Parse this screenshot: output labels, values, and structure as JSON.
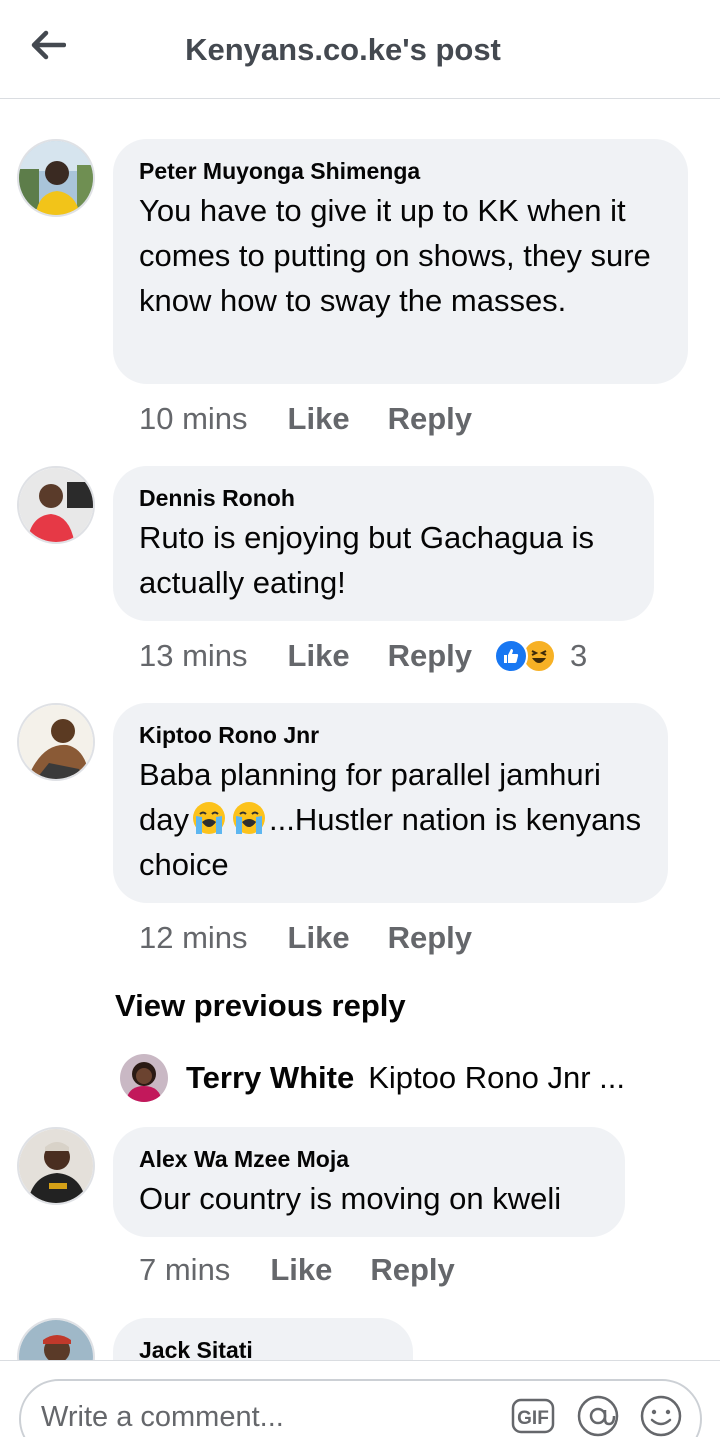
{
  "header": {
    "title": "Kenyans.co.ke's post",
    "back_icon": "arrow-left-icon"
  },
  "comments": [
    {
      "author": "Peter Muyonga Shimenga",
      "text": "You have to give it up to KK when it comes to putting on shows, they sure know how to sway the masses.",
      "time": "10 mins",
      "like": "Like",
      "reply": "Reply"
    },
    {
      "author": "Dennis Ronoh",
      "text": "Ruto is enjoying but Gachagua is actually eating!",
      "time": "13 mins",
      "like": "Like",
      "reply": "Reply",
      "reactions": {
        "icons": [
          "like-reaction-icon",
          "haha-reaction-icon"
        ],
        "count": "3"
      }
    },
    {
      "author": "Kiptoo Rono Jnr",
      "text_before": "Baba planning for parallel jamhuri day",
      "text_after": "...Hustler nation  is kenyans choice",
      "emojis": [
        "loudly-crying-face-icon",
        "loudly-crying-face-icon"
      ],
      "time": "12 mins",
      "like": "Like",
      "reply": "Reply"
    },
    {
      "author": "Alex Wa Mzee Moja",
      "text": "Our country is moving on kweli",
      "time": "7 mins",
      "like": "Like",
      "reply": "Reply"
    },
    {
      "author": "Jack Sitati"
    }
  ],
  "replies": {
    "view_previous": "View previous reply",
    "preview_name": "Terry White",
    "preview_text": "Kiptoo Rono Jnr ..."
  },
  "composer": {
    "placeholder": "Write a comment...",
    "gif_label": "GIF",
    "icons": [
      "gif-icon",
      "mention-icon",
      "emoji-icon"
    ]
  },
  "colors": {
    "bubble": "#f0f2f5",
    "meta_text": "#65676b",
    "like_blue": "#1877f2",
    "haha_yellow": "#f7b125"
  }
}
